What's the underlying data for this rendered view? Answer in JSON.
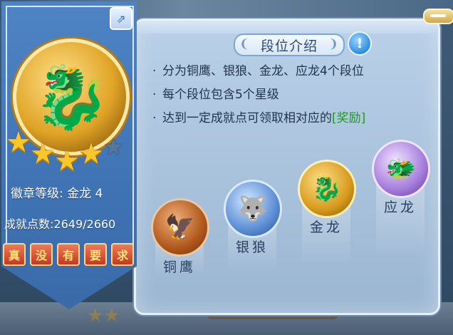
{
  "badge": {
    "level_label": "徽章等级:",
    "level_value": "金龙 4",
    "points_label": "成就点数:",
    "points_value": "2649/2660",
    "stars_filled": 4,
    "stars_total": 5,
    "requirement_buttons": [
      "真",
      "没",
      "有",
      "要",
      "求"
    ]
  },
  "intro": {
    "title": "段位介绍",
    "rules": [
      {
        "text": "分为铜鹰、银狼、金龙、应龙4个段位"
      },
      {
        "text": "每个段位包含5个星级"
      },
      {
        "text": "达到一定成就点可领取相对应的",
        "reward": "[奖励]"
      }
    ]
  },
  "tiers": [
    {
      "name": "铜鹰"
    },
    {
      "name": "银狼"
    },
    {
      "name": "金龙"
    },
    {
      "name": "应龙"
    }
  ],
  "icons": {
    "share": "share-icon",
    "info": "info-icon",
    "medal": "dragon-medal-icon"
  },
  "colors": {
    "reward": "#1e9a22",
    "ribbon": "#4f84c4",
    "panel": "#b9d0e8"
  }
}
